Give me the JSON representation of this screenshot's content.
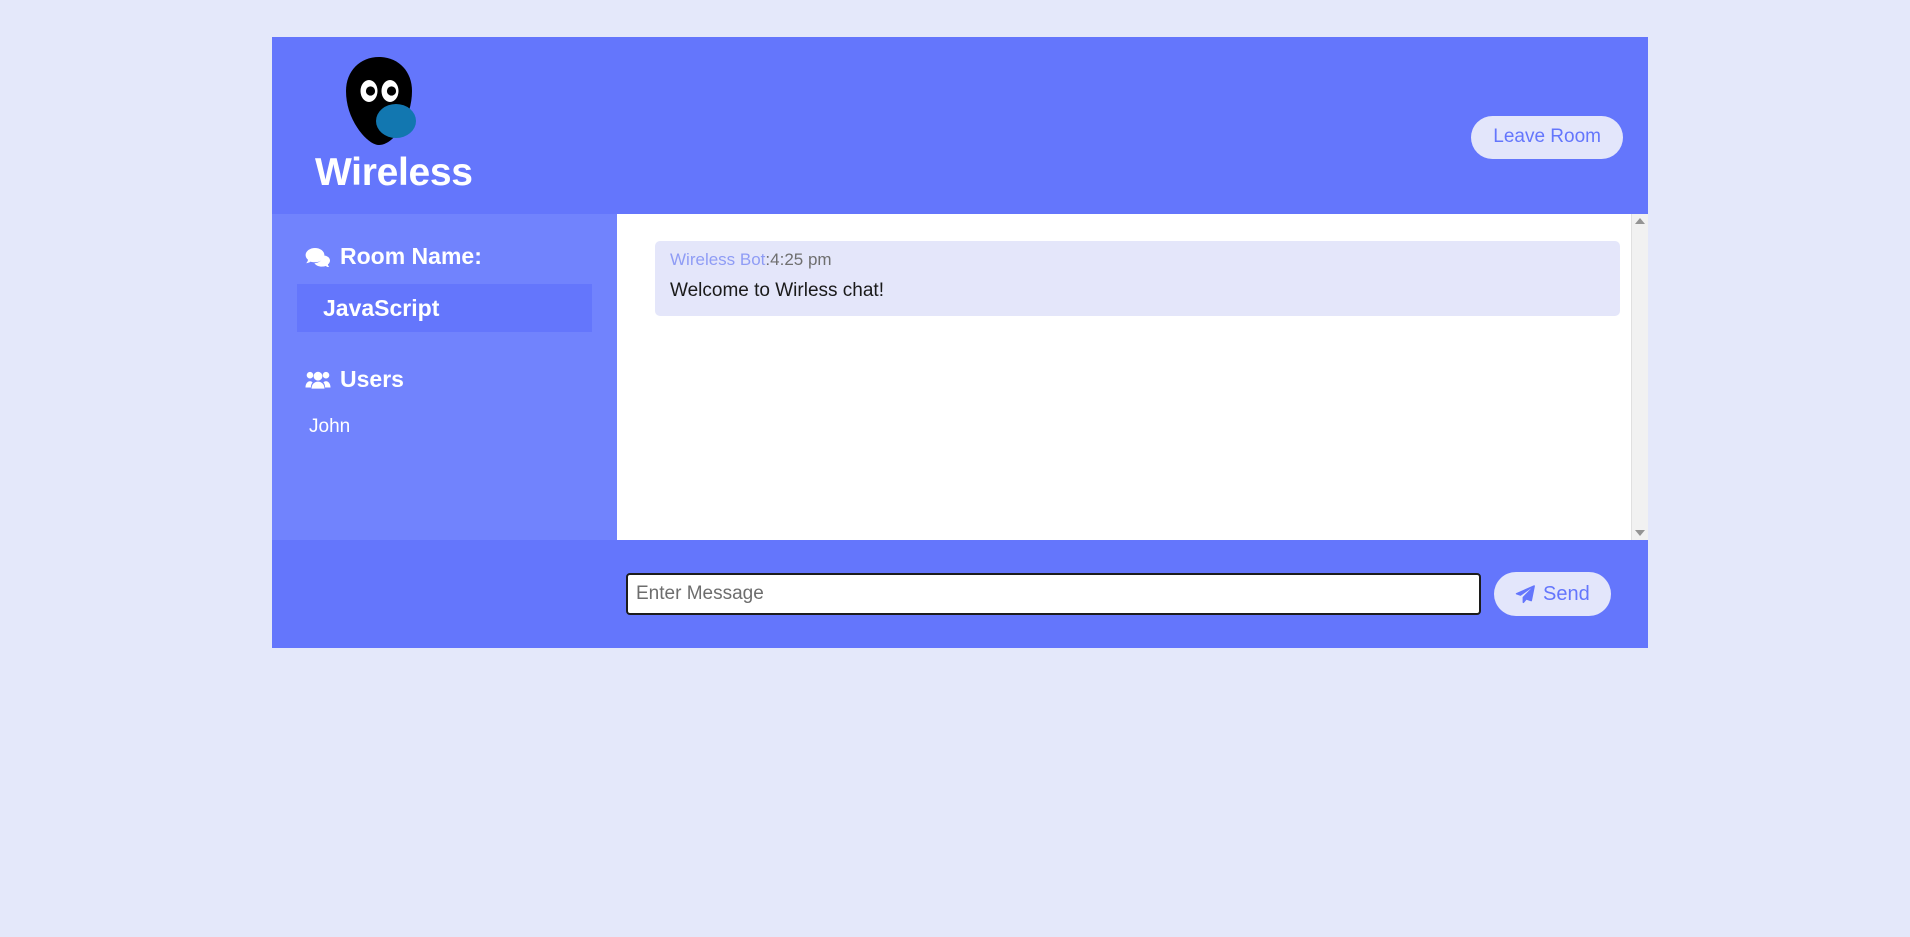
{
  "app": {
    "brand_title": "Wireless",
    "logo_icon": "owl-logo-icon"
  },
  "header": {
    "leave_room_label": "Leave Room"
  },
  "sidebar": {
    "room_name_heading": "Room Name:",
    "room_name_icon": "comments-icon",
    "room_name_value": "JavaScript",
    "users_heading": "Users",
    "users_icon": "users-icon",
    "users": [
      {
        "name": "John"
      }
    ]
  },
  "chat": {
    "messages": [
      {
        "author": "Wireless Bot",
        "separator": ":",
        "time": "4:25 pm",
        "text": "Welcome to Wirless chat!"
      }
    ],
    "scrollbar": {
      "up_icon": "scroll-up-arrow-icon",
      "down_icon": "scroll-down-arrow-icon"
    }
  },
  "form": {
    "input_placeholder": "Enter Message",
    "input_value": "",
    "send_label": "Send",
    "send_icon": "paper-plane-icon"
  },
  "colors": {
    "page_background": "#e4e8fa",
    "header_blue": "#6476fc",
    "sidebar_blue": "#7183fd",
    "bubble_lavender": "#e4e6fa",
    "button_lavender": "#e3e6fb",
    "accent_text": "#6476fc"
  }
}
